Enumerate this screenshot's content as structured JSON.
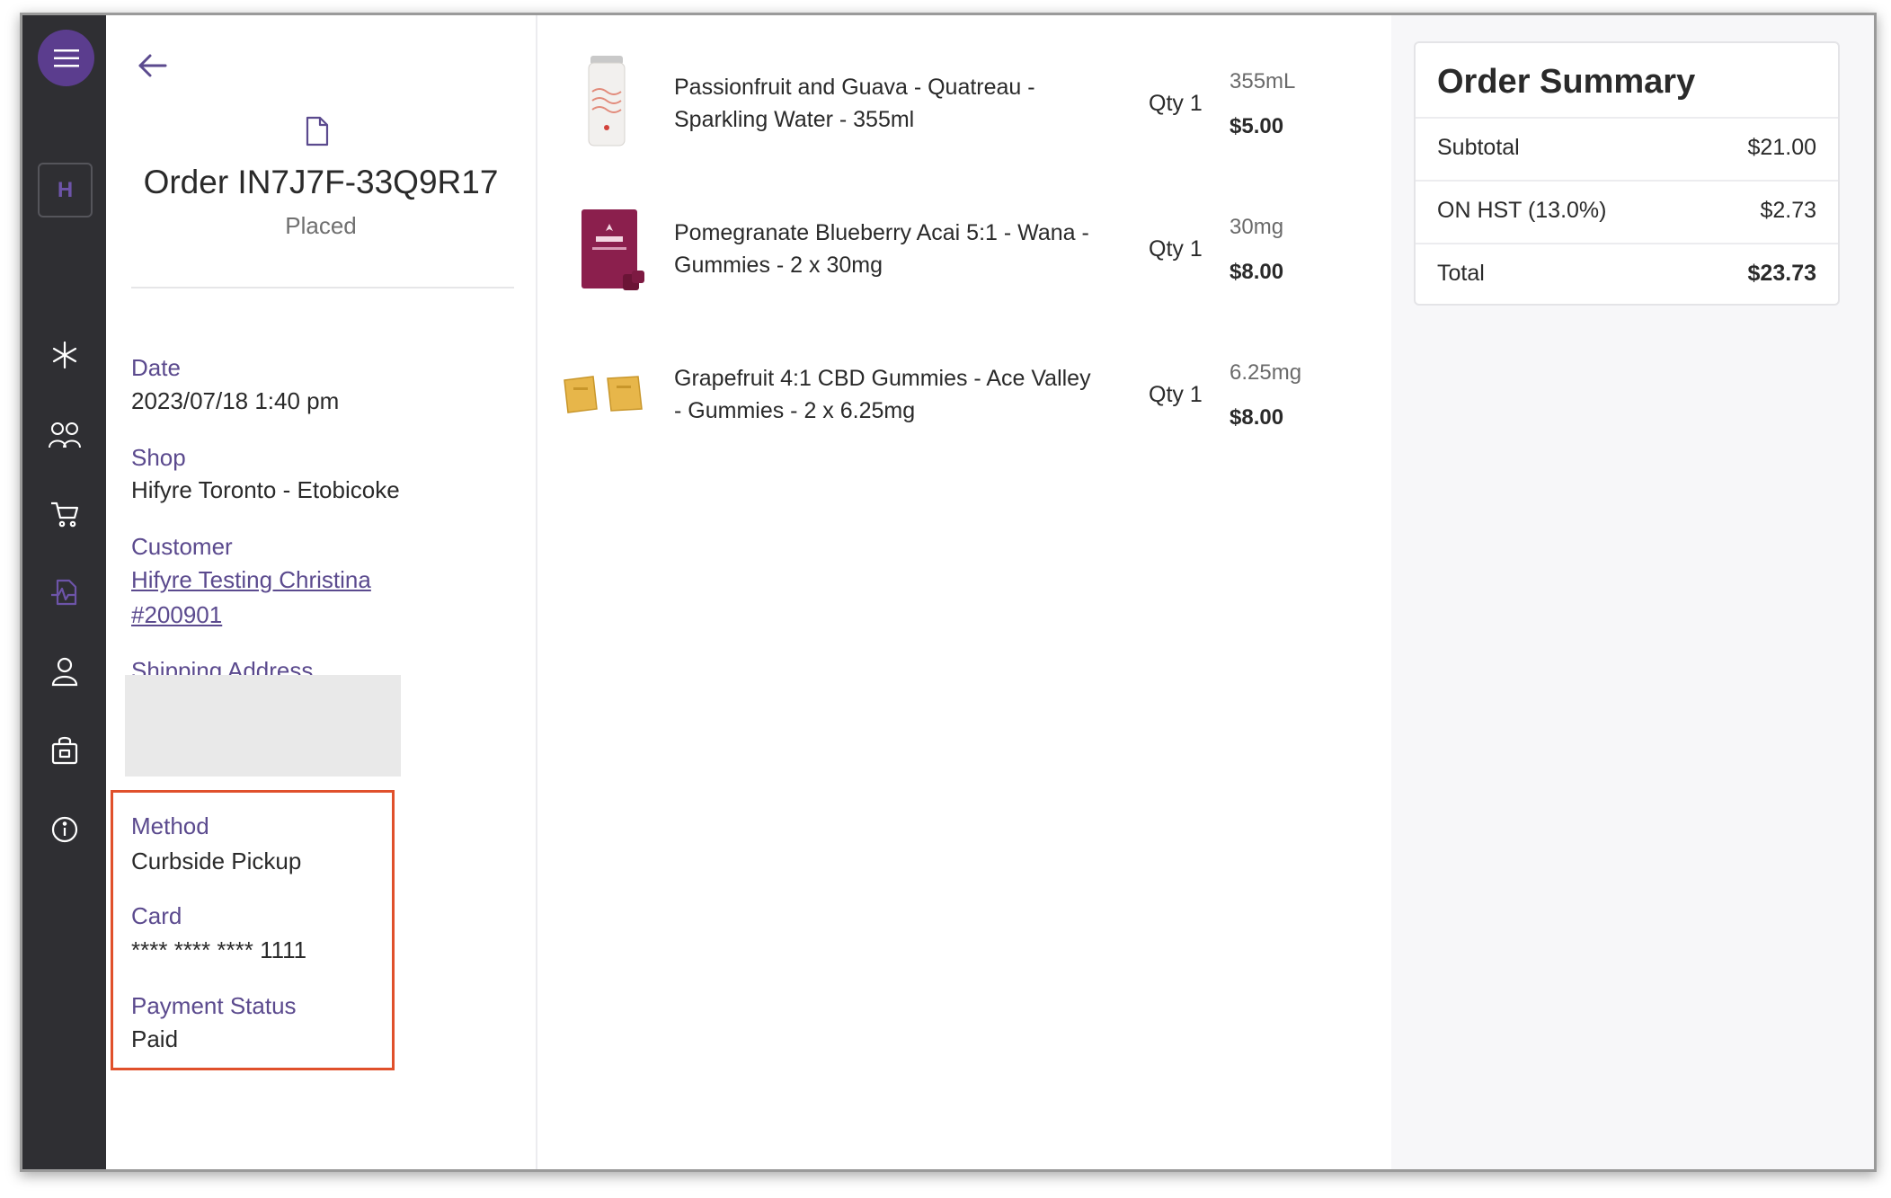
{
  "sidebar": {
    "shop_initial": "H"
  },
  "order": {
    "title": "Order IN7J7F-33Q9R17",
    "status": "Placed",
    "fields": {
      "date_label": "Date",
      "date_value": "2023/07/18 1:40 pm",
      "shop_label": "Shop",
      "shop_value": "Hifyre Toronto - Etobicoke",
      "customer_label": "Customer",
      "customer_name": "Hifyre Testing Christina",
      "customer_id": "#200901",
      "shipping_label": "Shipping Address",
      "method_label": "Method",
      "method_value": "Curbside Pickup",
      "card_label": "Card",
      "card_value": "**** **** **** 1111",
      "payment_label": "Payment Status",
      "payment_value": "Paid"
    }
  },
  "items": [
    {
      "name_line1": "Passionfruit and Guava - Quatreau -",
      "name_line2": "Sparkling Water - 355ml",
      "qty": "Qty 1",
      "size": "355mL",
      "price": "$5.00"
    },
    {
      "name_line1": "Pomegranate Blueberry Acai 5:1 - Wana -",
      "name_line2": "Gummies - 2 x 30mg",
      "qty": "Qty 1",
      "size": "30mg",
      "price": "$8.00"
    },
    {
      "name_line1": "Grapefruit 4:1 CBD Gummies - Ace Valley",
      "name_line2": "- Gummies - 2 x 6.25mg",
      "qty": "Qty 1",
      "size": "6.25mg",
      "price": "$8.00"
    }
  ],
  "summary": {
    "title": "Order Summary",
    "subtotal_label": "Subtotal",
    "subtotal_value": "$21.00",
    "tax_label": "ON HST (13.0%)",
    "tax_value": "$2.73",
    "total_label": "Total",
    "total_value": "$23.73"
  },
  "icons": {
    "menu": "hamburger-menu-icon",
    "sparkle": "sparkle-icon",
    "users": "users-icon",
    "cart": "cart-icon",
    "analytics": "analytics-icon",
    "profile": "user-icon",
    "bag": "shopping-bag-icon",
    "info": "info-icon",
    "back": "back-arrow-icon",
    "document": "document-icon"
  },
  "colors": {
    "sidebar_bg": "#2f2f33",
    "accent_purple": "#5b3d8e",
    "label_purple": "#5b4a8e",
    "highlight_border": "#e0502b"
  }
}
